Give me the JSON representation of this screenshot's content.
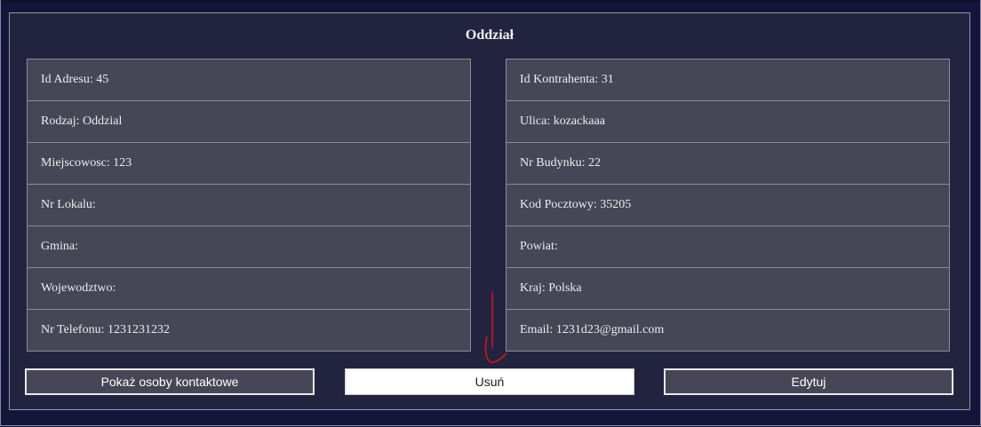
{
  "section": {
    "title": "Oddział"
  },
  "left_fields": [
    {
      "label": "Id Adresu:",
      "value": "45"
    },
    {
      "label": "Rodzaj:",
      "value": "Oddzial"
    },
    {
      "label": "Miejscowosc:",
      "value": "123"
    },
    {
      "label": "Nr Lokalu:",
      "value": ""
    },
    {
      "label": "Gmina:",
      "value": ""
    },
    {
      "label": "Wojewodztwo:",
      "value": ""
    },
    {
      "label": "Nr Telefonu:",
      "value": "1231231232"
    }
  ],
  "right_fields": [
    {
      "label": "Id Kontrahenta:",
      "value": "31"
    },
    {
      "label": "Ulica:",
      "value": "kozackaaa"
    },
    {
      "label": "Nr Budynku:",
      "value": "22"
    },
    {
      "label": "Kod Pocztowy:",
      "value": "35205"
    },
    {
      "label": "Powiat:",
      "value": ""
    },
    {
      "label": "Kraj:",
      "value": "Polska"
    },
    {
      "label": "Email:",
      "value": "1231d23@gmail.com"
    }
  ],
  "buttons": {
    "contacts": "Pokaż osoby kontaktowe",
    "delete": "Usuń",
    "edit": "Edytuj"
  },
  "colors": {
    "background": "#14153a",
    "card": "#22233f",
    "row": "#474657",
    "annotation": "#d01818"
  }
}
